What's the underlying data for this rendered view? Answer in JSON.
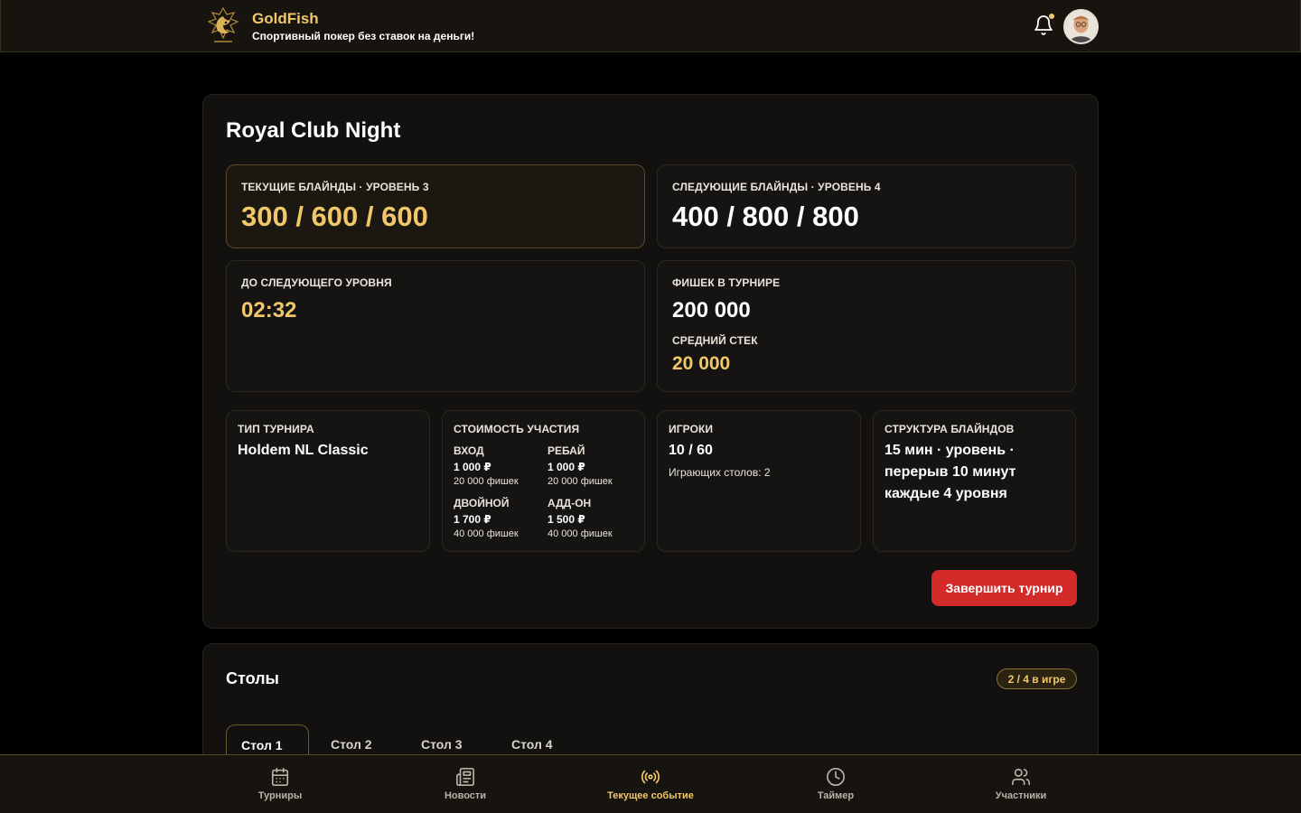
{
  "header": {
    "brand_name": "GoldFish",
    "tagline": "Спортивный покер без ставок на деньги!"
  },
  "event": {
    "title": "Royal Club Night",
    "current_blinds": {
      "label": "ТЕКУЩИЕ БЛАЙНДЫ · УРОВЕНЬ 3",
      "value": "300 / 600 / 600"
    },
    "next_blinds": {
      "label": "СЛЕДУЮЩИЕ БЛАЙНДЫ · УРОВЕНЬ 4",
      "value": "400 / 800 / 800"
    },
    "timer": {
      "label": "ДО СЛЕДУЮЩЕГО УРОВНЯ",
      "value": "02:32"
    },
    "chips": {
      "label": "ФИШЕК В ТУРНИРЕ",
      "value": "200 000",
      "avg_label": "СРЕДНИЙ СТЕК",
      "avg_value": "20 000"
    },
    "type": {
      "label": "ТИП ТУРНИРА",
      "value": "Holdem NL Classic"
    },
    "cost": {
      "label": "СТОИМОСТЬ УЧАСТИЯ",
      "entry": {
        "label": "ВХОД",
        "price": "1 000 ₽",
        "chips": "20 000 фишек"
      },
      "rebuy": {
        "label": "РЕБАЙ",
        "price": "1 000 ₽",
        "chips": "20 000 фишек"
      },
      "double": {
        "label": "ДВОЙНОЙ",
        "price": "1 700 ₽",
        "chips": "40 000 фишек"
      },
      "addon": {
        "label": "АДД-ОН",
        "price": "1 500 ₽",
        "chips": "40 000 фишек"
      }
    },
    "players": {
      "label": "ИГРОКИ",
      "value": "10 / 60",
      "tables_text": "Играющих столов: 2"
    },
    "structure": {
      "label": "СТРУКТУРА БЛАЙНДОВ",
      "line1": "15 мин · уровень ·",
      "line2": "перерыв 10 минут",
      "line3": "каждые 4 уровня"
    },
    "end_button": "Завершить турнир"
  },
  "tables": {
    "title": "Столы",
    "badge": "2 / 4 в игре",
    "tabs": [
      "Стол 1",
      "Стол 2",
      "Стол 3",
      "Стол 4"
    ]
  },
  "nav": {
    "items": [
      {
        "label": "Турниры",
        "icon": "calendar-icon"
      },
      {
        "label": "Новости",
        "icon": "newspaper-icon"
      },
      {
        "label": "Текущее событие",
        "icon": "broadcast-icon"
      },
      {
        "label": "Таймер",
        "icon": "clock-icon"
      },
      {
        "label": "Участники",
        "icon": "users-icon"
      }
    ],
    "active_index": 2
  },
  "colors": {
    "accent_gold": "#f0c76b",
    "danger": "#d32a2a",
    "background": "#000000"
  }
}
